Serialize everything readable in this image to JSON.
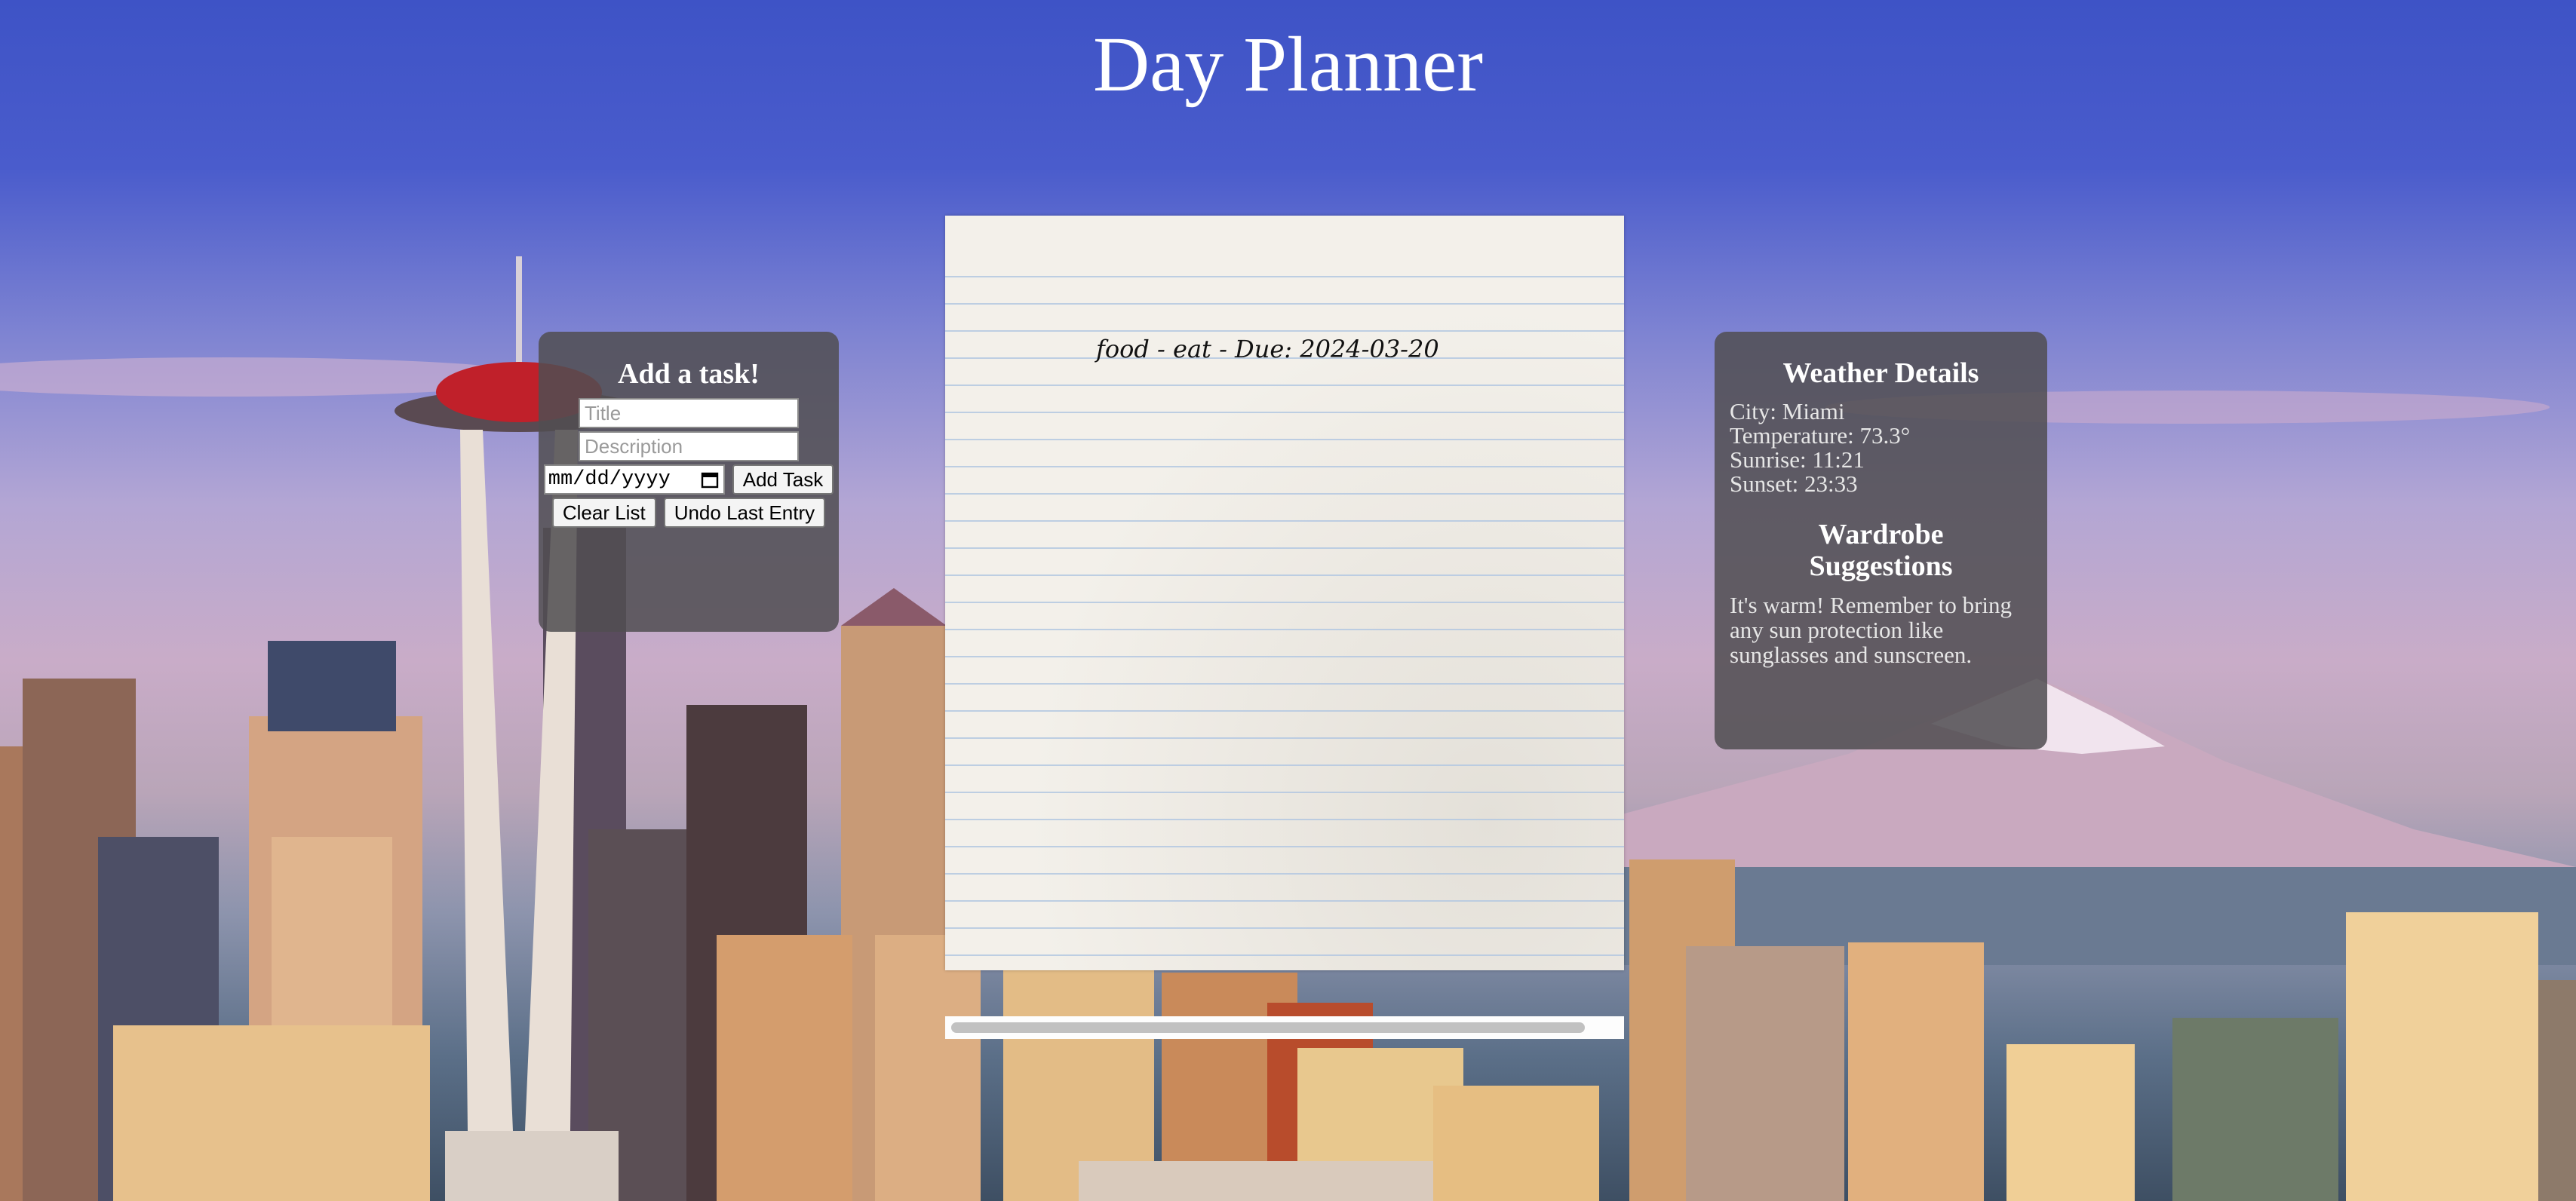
{
  "header": {
    "title": "Day Planner"
  },
  "task_form": {
    "heading": "Add a task!",
    "title_placeholder": "Title",
    "description_placeholder": "Description",
    "date_placeholder": "mm/dd/yyyy",
    "add_label": "Add Task",
    "clear_label": "Clear List",
    "undo_label": "Undo Last Entry"
  },
  "notepad": {
    "tasks": [
      {
        "text": "food - eat - Due: 2024-03-20"
      }
    ]
  },
  "weather": {
    "heading": "Weather Details",
    "city": "City: Miami",
    "temperature": "Temperature: 73.3°",
    "sunrise": "Sunrise: 11:21",
    "sunset": "Sunset: 23:33"
  },
  "wardrobe": {
    "heading": "Wardrobe Suggestions",
    "text": "It's warm! Remember to bring any sun protection like sunglasses and sunscreen."
  },
  "colors": {
    "panel_bg": "#504e52",
    "sky_top": "#3e53c6",
    "paper": "#f3f0ea"
  }
}
